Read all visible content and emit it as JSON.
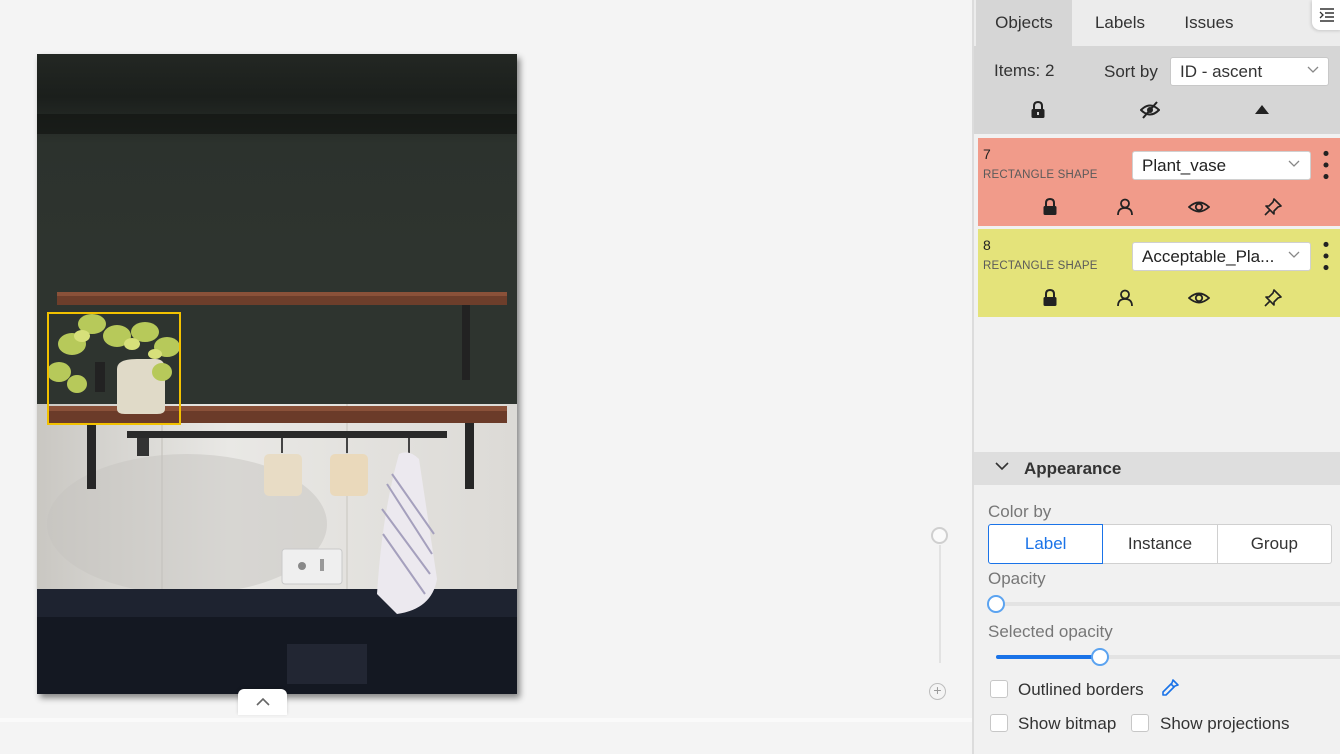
{
  "tabs": {
    "objects": "Objects",
    "labels": "Labels",
    "issues": "Issues"
  },
  "list": {
    "items_count": "Items: 2",
    "sort_label": "Sort by",
    "sort_value": "ID - ascent"
  },
  "objects": [
    {
      "id": "7",
      "type": "RECTANGLE SHAPE",
      "label": "Plant_vase",
      "color": "#f19b8a"
    },
    {
      "id": "8",
      "type": "RECTANGLE SHAPE",
      "label": "Acceptable_Pla...",
      "color": "#e4e37a"
    }
  ],
  "appearance": {
    "title": "Appearance",
    "color_by_label": "Color by",
    "color_by_options": [
      "Label",
      "Instance",
      "Group"
    ],
    "color_by_selected": "Label",
    "opacity_label": "Opacity",
    "opacity_value": 0.0,
    "selected_opacity_label": "Selected opacity",
    "selected_opacity_value": 0.3,
    "outlined_borders_label": "Outlined borders",
    "show_bitmap_label": "Show bitmap",
    "show_projections_label": "Show projections"
  },
  "colors": {
    "accent": "#1a73e8",
    "bbox": "#f2c100"
  },
  "icons": [
    "lock-icon",
    "eye-off-icon",
    "caret-up-icon",
    "user-icon",
    "eye-icon",
    "pin-icon",
    "more-vert-icon",
    "chevron-down-icon",
    "color-picker-icon",
    "sidebar-collapse-icon",
    "zoom-in-icon"
  ]
}
